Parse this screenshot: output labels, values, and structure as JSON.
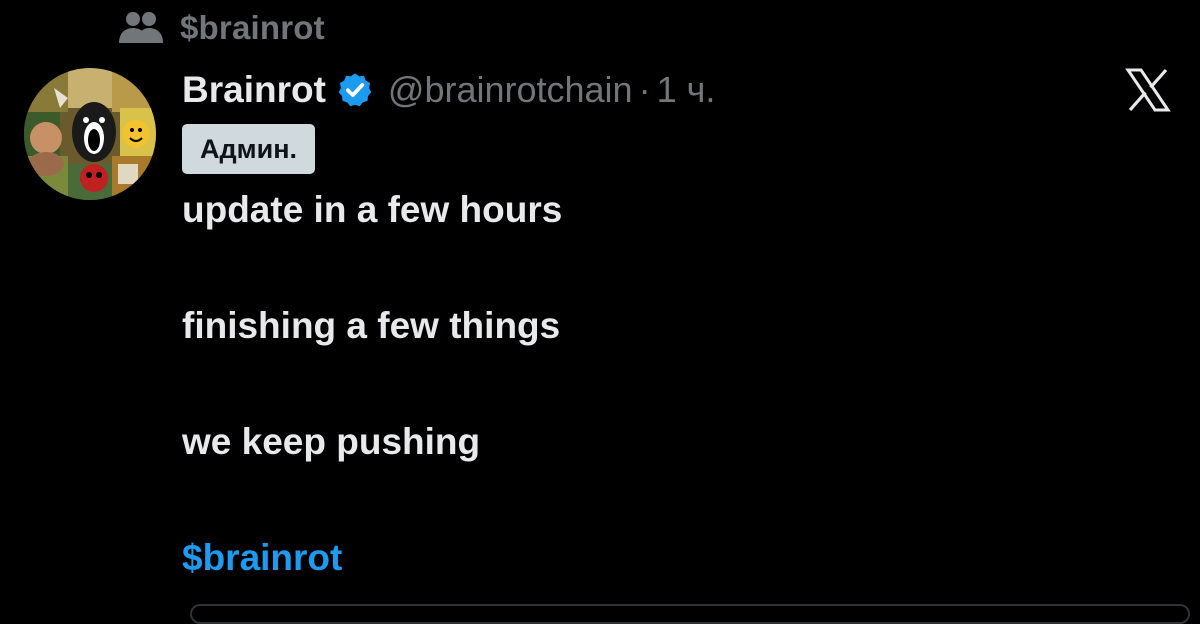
{
  "community": {
    "icon": "community-icon",
    "label": "$brainrot"
  },
  "author": {
    "avatar_icon": "avatar-image",
    "display_name": "Brainrot",
    "verified_icon": "verified-badge-icon",
    "handle": "@brainrotchain",
    "separator": "·",
    "time": "1 ч."
  },
  "role_badge": "Админ.",
  "tweet": {
    "line1": "update in a few hours",
    "line2": "finishing a few things",
    "line3": "we keep pushing",
    "hashtag": "$brainrot"
  },
  "x_logo_icon": "x-logo-icon",
  "colors": {
    "background": "#000000",
    "text": "#e7e9ea",
    "muted": "#71767b",
    "accent": "#1d9bf0",
    "badge_bg": "#cfd9de"
  }
}
